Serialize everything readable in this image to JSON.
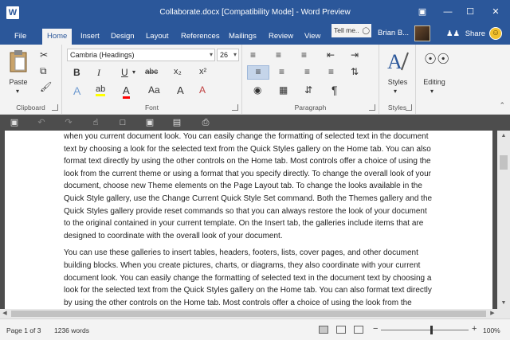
{
  "window": {
    "title": "Collaborate.docx [Compatibility Mode] - Word Preview",
    "app_icon": "W",
    "controls": {
      "restore": "▣",
      "minimize": "—",
      "maximize": "☐",
      "close": "✕"
    }
  },
  "tabs": [
    {
      "label": "File"
    },
    {
      "label": "Home"
    },
    {
      "label": "Insert"
    },
    {
      "label": "Design"
    },
    {
      "label": "Layout"
    },
    {
      "label": "References"
    },
    {
      "label": "Mailings"
    },
    {
      "label": "Review"
    },
    {
      "label": "View"
    }
  ],
  "active_tab": "Home",
  "tell_me": "Tell me..",
  "user": {
    "name": "Brian B..."
  },
  "share_label": "Share",
  "ribbon": {
    "clipboard": {
      "paste_label": "Paste",
      "group_label": "Clipboard"
    },
    "font": {
      "font_name": "Cambria (Headings)",
      "font_size": "26",
      "group_label": "Font",
      "buttons": {
        "bold": "B",
        "italic": "I",
        "underline": "U",
        "strike": "abc",
        "subscript": "x₂",
        "superscript": "x²",
        "effects": "A",
        "highlight": "ab",
        "color": "A",
        "case": "Aa",
        "grow": "A",
        "clear": "A"
      }
    },
    "paragraph": {
      "group_label": "Paragraph",
      "pilcrow": "¶"
    },
    "styles": {
      "label": "Styles",
      "group_label": "Styles"
    },
    "editing": {
      "label": "Editing"
    }
  },
  "document": {
    "paragraphs": [
      "when you current document look. You can easily change the formatting of selected text in the document text by choosing a look for the selected text from the Quick Styles gallery on the Home tab. You can also format text directly by using the other controls on the Home tab. Most controls offer a choice of using the look from the current theme or using a format that you specify directly. To change the overall look of your document, choose new Theme elements on the Page Layout tab. To change the looks available in the Quick Style gallery, use the Change Current Quick Style Set command. Both the Themes gallery and the Quick Styles gallery provide reset commands so that you can always restore the look of your document to the original contained in your current template. On the Insert tab, the galleries include items that are designed to coordinate with the overall look of your document.",
      "You can use these galleries to insert tables, headers, footers, lists, cover pages, and other document building blocks. When you create pictures, charts, or diagrams, they also coordinate with your current document look. You can easily change the formatting of selected text in the document text by choosing a look for the selected text from the Quick Styles gallery on the Home tab. You can also format text directly by using the other controls on the Home tab. Most controls offer a choice of using the look from the current theme or using a format that you specify directly. To change the overall look of"
    ]
  },
  "status": {
    "page": "Page 1 of 3",
    "words": "1236 words",
    "zoom": "100%",
    "zoom_minus": "−",
    "zoom_plus": "+"
  },
  "colors": {
    "accent": "#2b579a",
    "ribbon_bg": "#f3f3f3",
    "workspace": "#4d4d4d",
    "highlight_yellow": "#ffff00",
    "font_red": "#ff0000"
  }
}
